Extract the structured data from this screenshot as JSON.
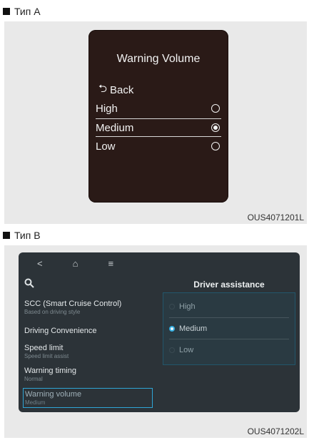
{
  "typeA": {
    "label": "Тип A",
    "screen": {
      "title": "Warning Volume",
      "back_label": "Back",
      "options": [
        {
          "label": "High",
          "selected": false
        },
        {
          "label": "Medium",
          "selected": true
        },
        {
          "label": "Low",
          "selected": false
        }
      ]
    },
    "code": "OUS4071201L"
  },
  "typeB": {
    "label": "Тип B",
    "screen": {
      "nav_icons": [
        "back-icon",
        "home-icon",
        "menu-icon"
      ],
      "right_title": "Driver assistance",
      "menu": [
        {
          "title": "SCC (Smart Cruise Control)",
          "subtitle": "Based on driving style"
        },
        {
          "title": "Driving Convenience",
          "subtitle": ""
        },
        {
          "title": "Speed limit",
          "subtitle": "Speed limit assist"
        },
        {
          "title": "Warning timing",
          "subtitle": "Normal"
        },
        {
          "title": "Warning volume",
          "subtitle": "Medium"
        }
      ],
      "options": [
        {
          "label": "High",
          "selected": false
        },
        {
          "label": "Medium",
          "selected": true
        },
        {
          "label": "Low",
          "selected": false
        }
      ]
    },
    "code": "OUS4071202L"
  },
  "colors": {
    "typeA_bg": "#2a1a17",
    "typeB_bg": "#2c3338",
    "accent": "#35aee0"
  }
}
